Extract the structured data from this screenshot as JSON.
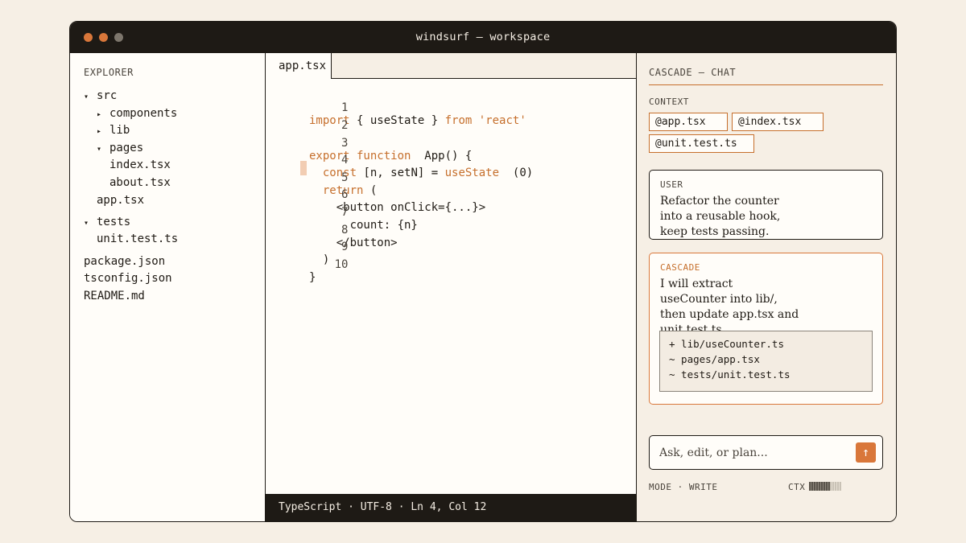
{
  "window": {
    "title": "windsurf — workspace",
    "traffic_lights": [
      "close",
      "minimize",
      "zoom"
    ]
  },
  "explorer": {
    "heading": "EXPLORER",
    "tree": [
      {
        "label": "src",
        "caret": "▾"
      },
      {
        "label": "components",
        "caret": "▸"
      },
      {
        "label": "lib",
        "caret": "▸"
      },
      {
        "label": "pages",
        "caret": "▾"
      },
      {
        "label": "index.tsx",
        "caret": ""
      },
      {
        "label": "about.tsx",
        "caret": ""
      },
      {
        "label": "app.tsx",
        "caret": ""
      },
      {
        "label": "tests",
        "caret": "▾"
      },
      {
        "label": "unit.test.ts",
        "caret": ""
      },
      {
        "label": "package.json",
        "caret": ""
      },
      {
        "label": "tsconfig.json",
        "caret": ""
      },
      {
        "label": "README.md",
        "caret": ""
      }
    ]
  },
  "editor": {
    "tab": "app.tsx",
    "lines": [
      {
        "n": "1"
      },
      {
        "n": "2"
      },
      {
        "n": "3"
      },
      {
        "n": "4"
      },
      {
        "n": "5"
      },
      {
        "n": "6"
      },
      {
        "n": "7"
      },
      {
        "n": "8"
      },
      {
        "n": "9"
      },
      {
        "n": "10"
      }
    ],
    "code": {
      "l1_import": "import",
      "l1_mid": " { useState } ",
      "l1_from": "from",
      "l1_str": " 'react'",
      "l3_export": "export function",
      "l3_rest": "  App() {",
      "l4_const": "  const",
      "l4_mid": " [n, setN] = ",
      "l4_call": "useState",
      "l4_rest": "  (0)",
      "l5_return": "  return",
      "l5_rest": " (",
      "l6": "    <button onClick={...}>",
      "l7": "      count: {n}",
      "l8": "    </button>",
      "l9": "  )",
      "l10": "}"
    },
    "status": "TypeScript · UTF-8 · Ln 4, Col 12"
  },
  "chat": {
    "heading": "CASCADE — CHAT",
    "context_label": "CONTEXT",
    "context_chips": [
      "@app.tsx",
      "@index.tsx",
      "@unit.test.ts"
    ],
    "user_message": {
      "role": "USER",
      "text": "Refactor the counter into a reusable hook, keep tests passing."
    },
    "cascade_message": {
      "role": "CASCADE",
      "text": "I will extract useCounter into lib/, then update app.tsx and unit.test.ts.",
      "diff": [
        "+ lib/useCounter.ts",
        "~ pages/app.tsx",
        "~ tests/unit.test.ts"
      ]
    },
    "input_placeholder": "Ask, edit, or plan...",
    "send_icon": "arrow-up-icon",
    "mode": "MODE · WRITE",
    "ctx_label": "CTX",
    "ctx_usage": 0.65
  },
  "colors": {
    "accent": "#d9773a",
    "ink": "#1e1a15",
    "paper": "#f6efe5"
  }
}
